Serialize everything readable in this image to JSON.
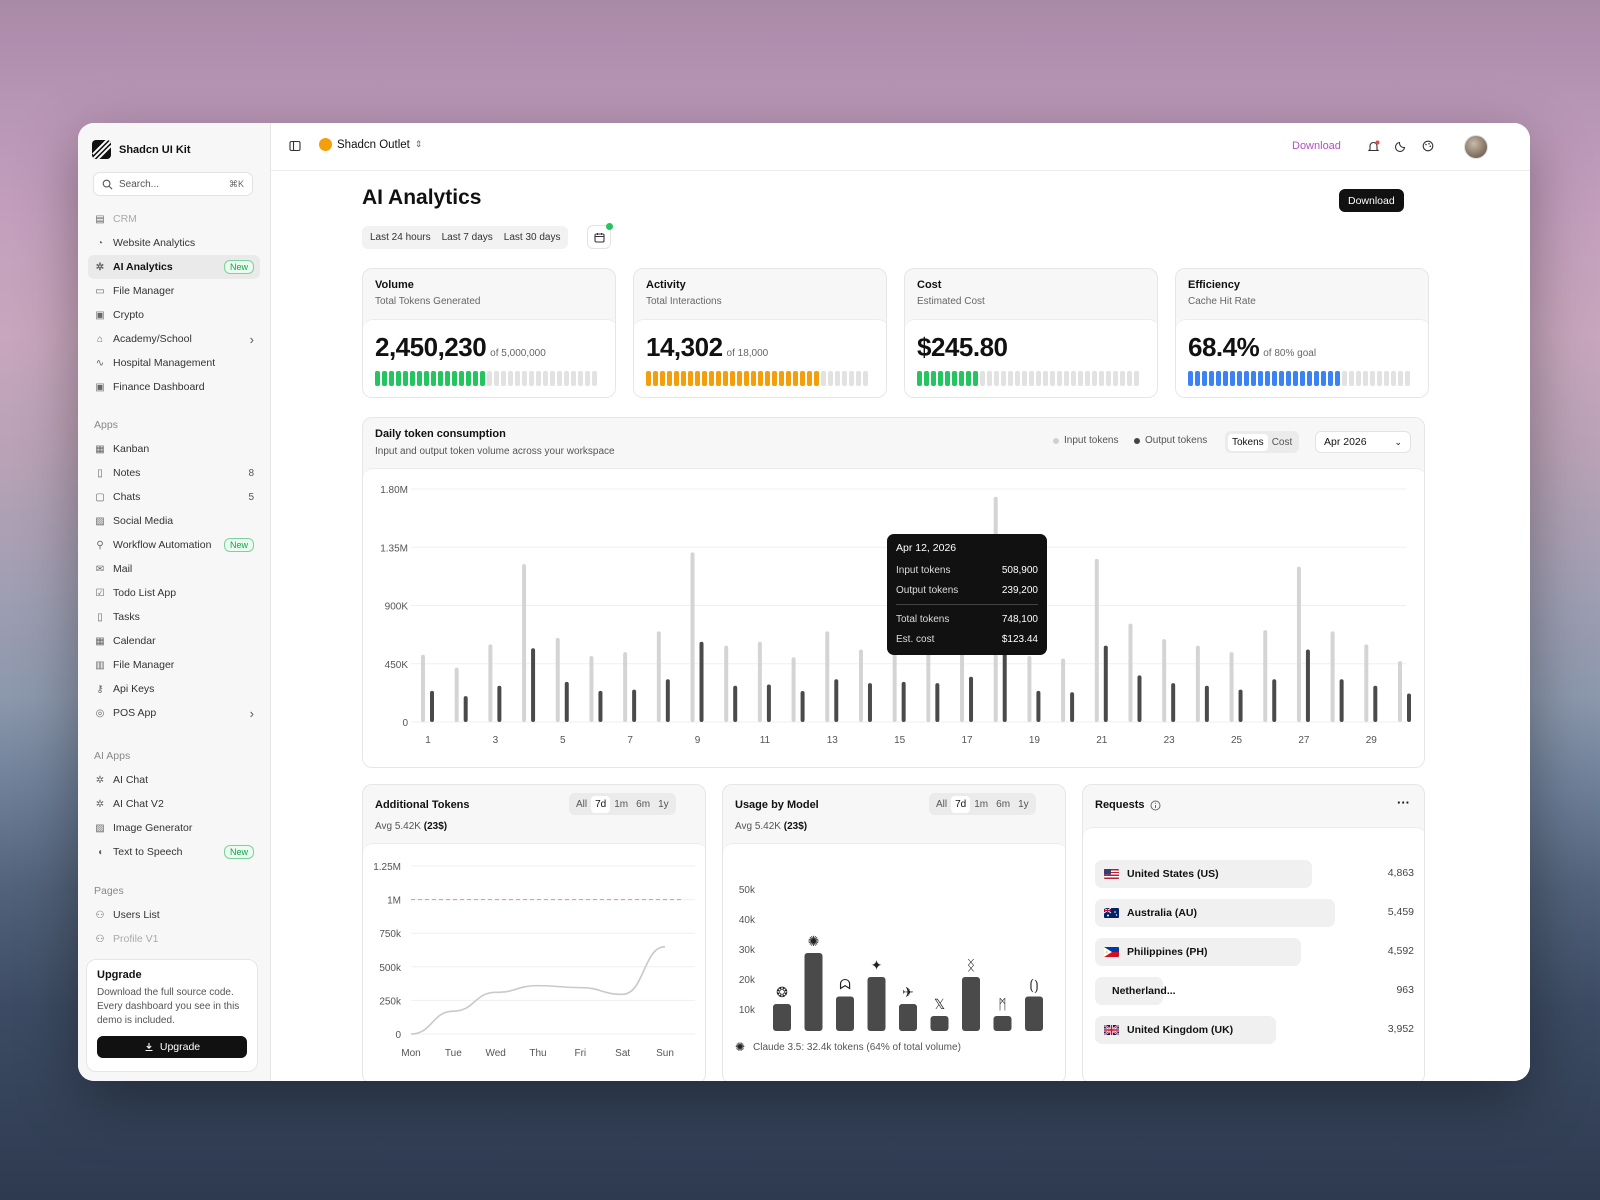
{
  "brand": "Shadcn UI Kit",
  "search": {
    "placeholder": "Search...",
    "shortcut": "⌘K"
  },
  "nav_top": [
    {
      "label": "CRM",
      "icon": "chart-icon",
      "dim": true
    },
    {
      "label": "Website Analytics",
      "icon": "gauge-icon"
    },
    {
      "label": "AI Analytics",
      "icon": "ai-icon",
      "active": true,
      "badge": "New"
    },
    {
      "label": "File Manager",
      "icon": "folder-icon"
    },
    {
      "label": "Crypto",
      "icon": "wallet-icon"
    },
    {
      "label": "Academy/School",
      "icon": "graduation-icon",
      "chevron": true
    },
    {
      "label": "Hospital Management",
      "icon": "pulse-icon"
    },
    {
      "label": "Finance Dashboard",
      "icon": "wallet-icon"
    }
  ],
  "apps_title": "Apps",
  "nav_apps": [
    {
      "label": "Kanban",
      "icon": "kanban-icon"
    },
    {
      "label": "Notes",
      "icon": "note-icon",
      "count": "8"
    },
    {
      "label": "Chats",
      "icon": "chat-icon",
      "count": "5"
    },
    {
      "label": "Social Media",
      "icon": "image-icon"
    },
    {
      "label": "Workflow Automation",
      "icon": "workflow-icon",
      "badge": "New"
    },
    {
      "label": "Mail",
      "icon": "mail-icon"
    },
    {
      "label": "Todo List App",
      "icon": "check-square-icon"
    },
    {
      "label": "Tasks",
      "icon": "clipboard-icon"
    },
    {
      "label": "Calendar",
      "icon": "calendar-icon"
    },
    {
      "label": "File Manager",
      "icon": "archive-icon"
    },
    {
      "label": "Api Keys",
      "icon": "key-icon"
    },
    {
      "label": "POS App",
      "icon": "pos-icon",
      "chevron": true
    }
  ],
  "ai_title": "AI Apps",
  "nav_ai": [
    {
      "label": "AI Chat",
      "icon": "ai-icon"
    },
    {
      "label": "AI Chat V2",
      "icon": "ai-icon"
    },
    {
      "label": "Image Generator",
      "icon": "image-icon"
    },
    {
      "label": "Text to Speech",
      "icon": "speech-icon",
      "badge": "New"
    }
  ],
  "pages_title": "Pages",
  "nav_pages": [
    {
      "label": "Users List",
      "icon": "users-icon"
    },
    {
      "label": "Profile V1",
      "icon": "user-icon",
      "dim": true
    }
  ],
  "upgrade": {
    "title": "Upgrade",
    "text": "Download the full source code. Every dashboard you see in this demo is included.",
    "button": "Upgrade"
  },
  "topbar": {
    "shop": "Shadcn Outlet",
    "download": "Download"
  },
  "page": {
    "title": "AI Analytics",
    "download": "Download",
    "ranges": [
      "Last 24 hours",
      "Last 7 days",
      "Last 30 days"
    ]
  },
  "kpis": [
    {
      "title": "Volume",
      "subtitle": "Total Tokens Generated",
      "value": "2,450,230",
      "of": "of 5,000,000",
      "fill": 0.49,
      "color": "#22c55e"
    },
    {
      "title": "Activity",
      "subtitle": "Total Interactions",
      "value": "14,302",
      "of": "of 18,000",
      "fill": 0.79,
      "color": "#f59e0b"
    },
    {
      "title": "Cost",
      "subtitle": "Estimated Cost",
      "value": "$245.80",
      "of": "",
      "fill": 0.27,
      "color": "#22c55e"
    },
    {
      "title": "Efficiency",
      "subtitle": "Cache Hit Rate",
      "value": "68.4%",
      "of": "of 80% goal",
      "fill": 0.68,
      "color": "#3b82f6"
    }
  ],
  "daily": {
    "title": "Daily token consumption",
    "subtitle": "Input and output token volume across your workspace",
    "legend": [
      "Input tokens",
      "Output tokens"
    ],
    "toggle": [
      "Tokens",
      "Cost"
    ],
    "toggle_active": "Tokens",
    "month": "Apr 2026",
    "tooltip": {
      "date": "Apr 12, 2026",
      "rows": [
        [
          "Input tokens",
          "508,900"
        ],
        [
          "Output tokens",
          "239,200"
        ]
      ],
      "rows2": [
        [
          "Total tokens",
          "748,100"
        ],
        [
          "Est. cost",
          "$123.44"
        ]
      ]
    }
  },
  "additional": {
    "title": "Additional Tokens",
    "avg": "Avg 5.42K",
    "avg_b": "(23$)",
    "tabs": [
      "All",
      "7d",
      "1m",
      "6m",
      "1y"
    ],
    "active": "7d"
  },
  "usage": {
    "title": "Usage by Model",
    "avg": "Avg 5.42K",
    "avg_b": "(23$)",
    "tabs": [
      "All",
      "7d",
      "1m",
      "6m",
      "1y"
    ],
    "active": "7d",
    "footer": "Claude 3.5: 32.4k tokens (64% of total volume)"
  },
  "requests": {
    "title": "Requests",
    "items": [
      {
        "country": "United States (US)",
        "value": "4,863",
        "flag": "us",
        "share": 0.89
      },
      {
        "country": "Australia (AU)",
        "value": "5,459",
        "flag": "au",
        "share": 1.0
      },
      {
        "country": "Philippines (PH)",
        "value": "4,592",
        "flag": "ph",
        "share": 0.84
      },
      {
        "country": "Netherland...",
        "value": "963",
        "flag": "nl",
        "share": 0.18
      },
      {
        "country": "United Kingdom (UK)",
        "value": "3,952",
        "flag": "uk",
        "share": 0.72
      }
    ]
  },
  "chart_data": [
    {
      "type": "bar",
      "title": "Daily token consumption",
      "x": [
        1,
        2,
        3,
        4,
        5,
        6,
        7,
        8,
        9,
        10,
        11,
        12,
        13,
        14,
        15,
        16,
        17,
        18,
        19,
        20,
        21,
        22,
        23,
        24,
        25,
        26,
        27,
        28,
        29,
        30
      ],
      "xticks": [
        "1",
        "3",
        "5",
        "7",
        "9",
        "11",
        "13",
        "15",
        "17",
        "19",
        "21",
        "23",
        "25",
        "27",
        "29"
      ],
      "yticks": [
        "0",
        "450K",
        "900K",
        "1.35M",
        "1.80M"
      ],
      "ylim": [
        0,
        1800000
      ],
      "series": [
        {
          "name": "Input tokens",
          "color": "#d4d4d4",
          "values": [
            520000,
            420000,
            600000,
            1220000,
            650000,
            510000,
            540000,
            700000,
            1310000,
            590000,
            620000,
            500000,
            700000,
            560000,
            820000,
            860000,
            640000,
            1740000,
            510000,
            490000,
            1260000,
            760000,
            640000,
            590000,
            540000,
            710000,
            1200000,
            700000,
            600000,
            470000
          ]
        },
        {
          "name": "Output tokens",
          "color": "#4a4a4a",
          "values": [
            240000,
            200000,
            280000,
            570000,
            310000,
            240000,
            250000,
            330000,
            620000,
            280000,
            290000,
            239200,
            330000,
            300000,
            310000,
            300000,
            350000,
            820000,
            240000,
            230000,
            590000,
            360000,
            300000,
            280000,
            250000,
            330000,
            560000,
            330000,
            280000,
            220000
          ]
        }
      ]
    },
    {
      "type": "line",
      "title": "Additional Tokens",
      "categories": [
        "Mon",
        "Tue",
        "Wed",
        "Thu",
        "Fri",
        "Sat",
        "Sun"
      ],
      "values": [
        0,
        170000,
        310000,
        360000,
        345000,
        295000,
        650000
      ],
      "reference": 1000000,
      "yticks": [
        "0",
        "250k",
        "500k",
        "750k",
        "1M",
        "1.25M"
      ],
      "ylim": [
        0,
        1250000
      ]
    },
    {
      "type": "bar",
      "title": "Usage by Model",
      "categories": [
        "openai-icon",
        "claude-icon",
        "llama-icon",
        "gemini-icon",
        "deepseek-icon",
        "x-icon",
        "mistral-icon",
        "perplexity-icon",
        "copilot-icon"
      ],
      "values": [
        9000,
        26000,
        11500,
        18000,
        9000,
        5000,
        18000,
        5000,
        11500
      ],
      "yticks": [
        "10k",
        "20k",
        "30k",
        "40k",
        "50k"
      ],
      "ylim": [
        0,
        50000
      ]
    }
  ]
}
